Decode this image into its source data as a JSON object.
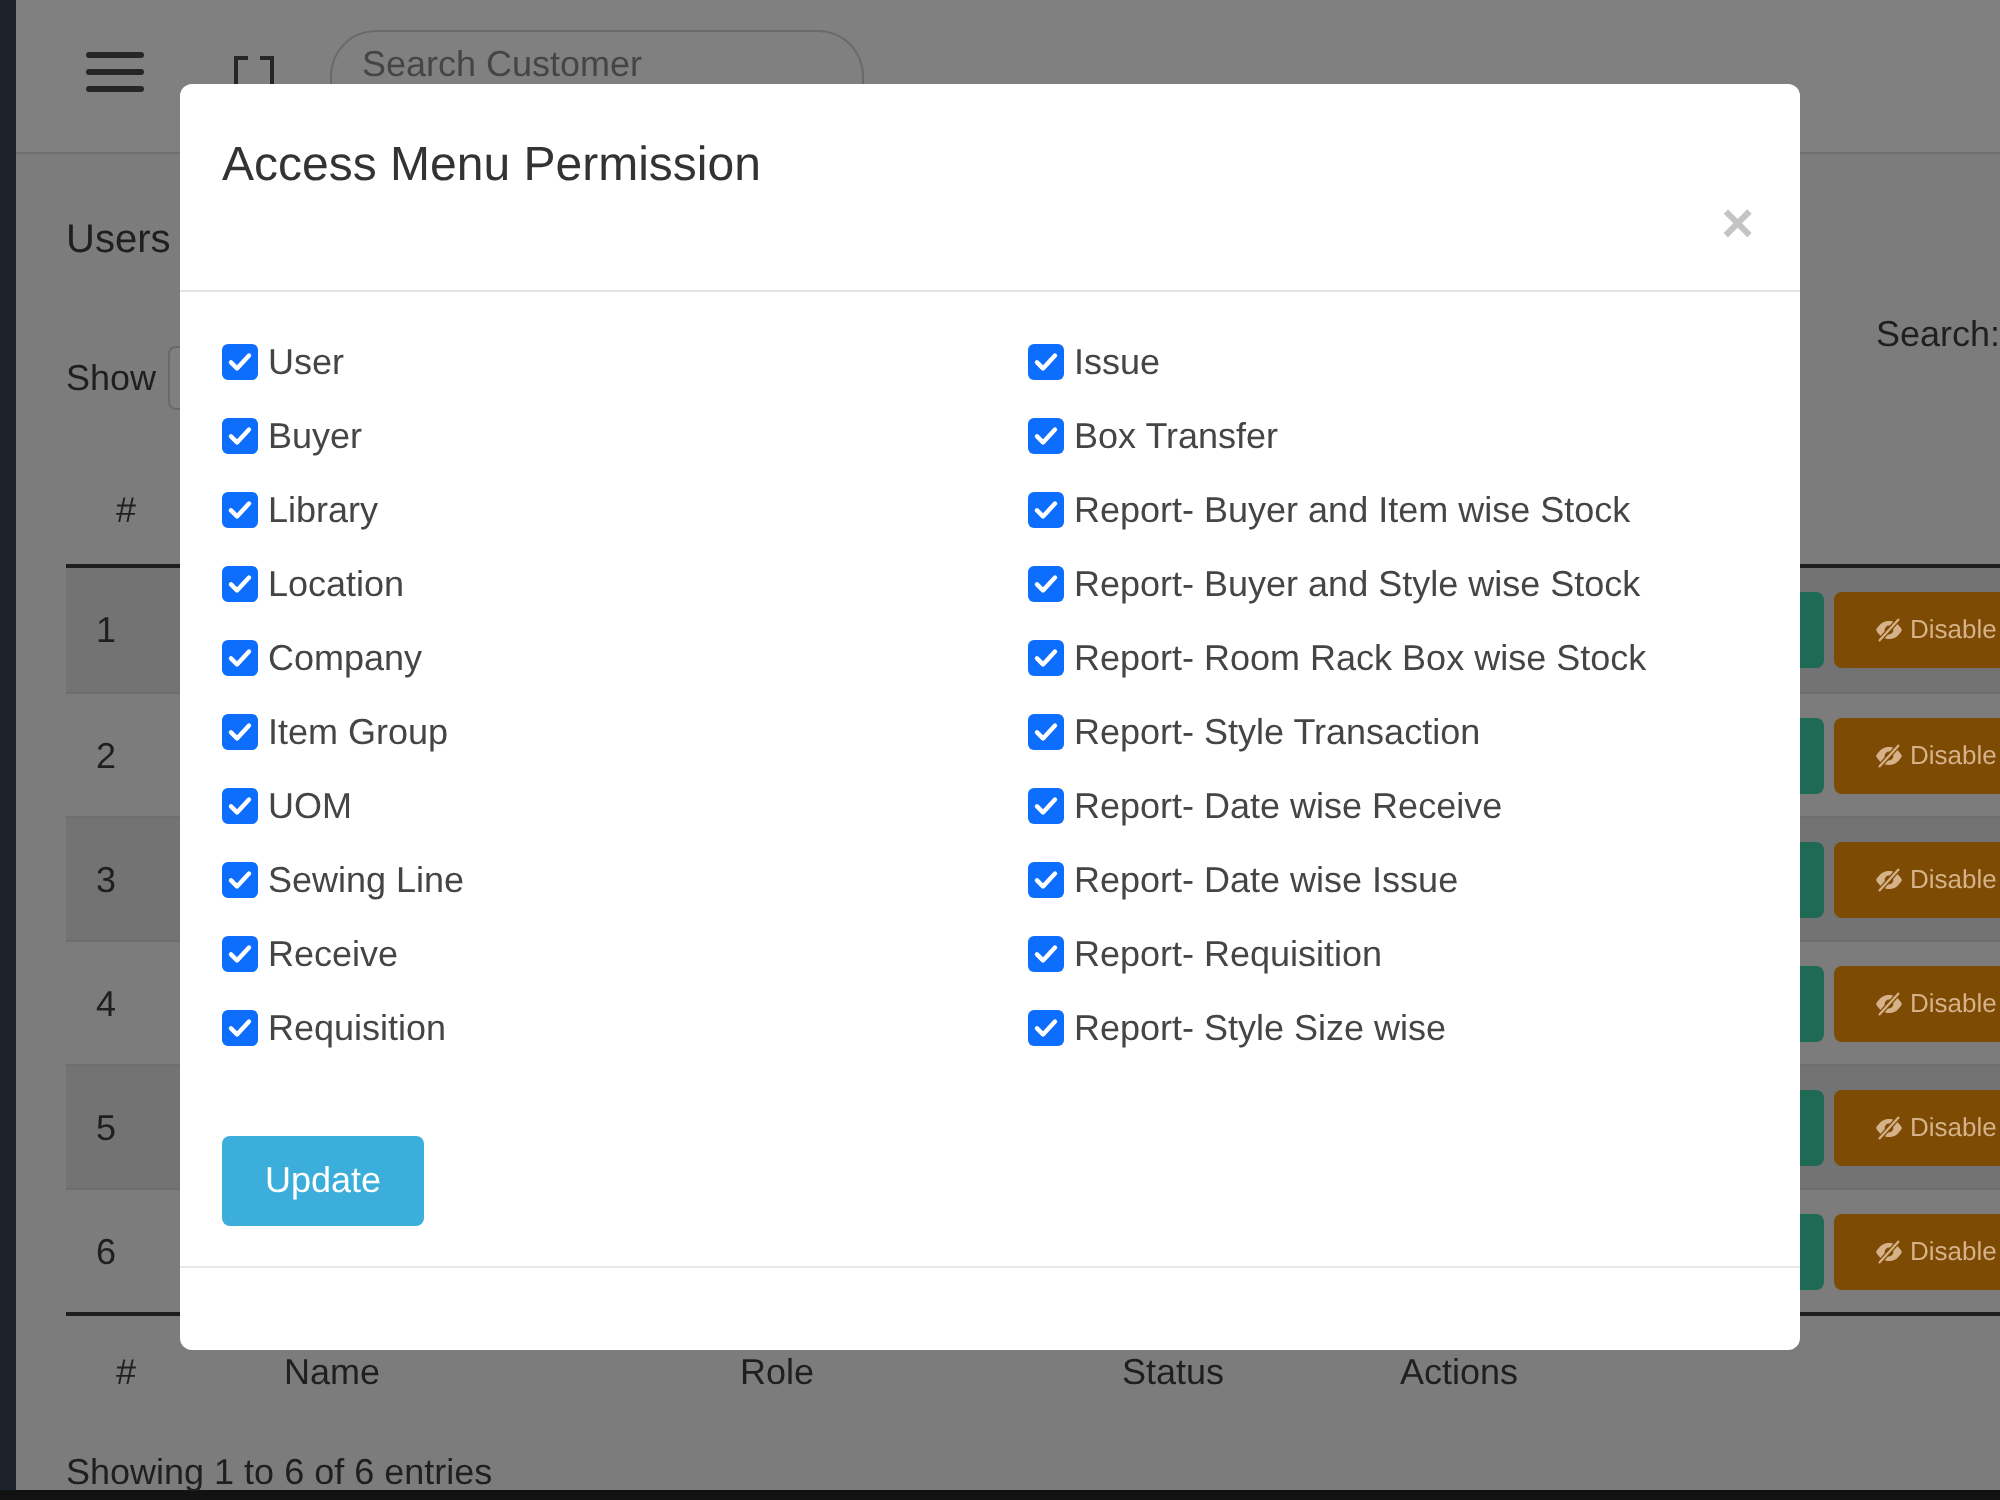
{
  "header": {
    "search": {
      "placeholder": "Search Customer"
    }
  },
  "page": {
    "title": "Users",
    "length_label": "Show",
    "search_label": "Search:"
  },
  "table": {
    "columns": [
      "#"
    ],
    "rows": [
      {
        "index": "1",
        "action": "Disable"
      },
      {
        "index": "2",
        "action": "Disable"
      },
      {
        "index": "3",
        "action": "Disable"
      },
      {
        "index": "4",
        "action": "Disable"
      },
      {
        "index": "5",
        "action": "Disable"
      },
      {
        "index": "6",
        "action": "Disable"
      }
    ],
    "footer_columns": [
      "#",
      "Name",
      "Role",
      "Status",
      "Actions"
    ],
    "info": "Showing 1 to 6 of 6 entries"
  },
  "modal": {
    "title": "Access Menu Permission",
    "close": "×",
    "permissions": [
      {
        "label": "User",
        "checked": true
      },
      {
        "label": "Buyer",
        "checked": true
      },
      {
        "label": "Library",
        "checked": true
      },
      {
        "label": "Location",
        "checked": true
      },
      {
        "label": "Company",
        "checked": true
      },
      {
        "label": "Item Group",
        "checked": true
      },
      {
        "label": "UOM",
        "checked": true
      },
      {
        "label": "Sewing Line",
        "checked": true
      },
      {
        "label": "Receive",
        "checked": true
      },
      {
        "label": "Requisition",
        "checked": true
      },
      {
        "label": "Issue",
        "checked": true
      },
      {
        "label": "Box Transfer",
        "checked": true
      },
      {
        "label": "Report- Buyer and Item wise Stock",
        "checked": true
      },
      {
        "label": "Report- Buyer and Style wise Stock",
        "checked": true
      },
      {
        "label": "Report- Room Rack Box wise Stock",
        "checked": true
      },
      {
        "label": "Report- Style Transaction",
        "checked": true
      },
      {
        "label": "Report- Date wise Receive",
        "checked": true
      },
      {
        "label": "Report- Date wise Issue",
        "checked": true
      },
      {
        "label": "Report- Requisition",
        "checked": true
      },
      {
        "label": "Report- Style Size wise",
        "checked": true
      }
    ],
    "button": "Update"
  }
}
